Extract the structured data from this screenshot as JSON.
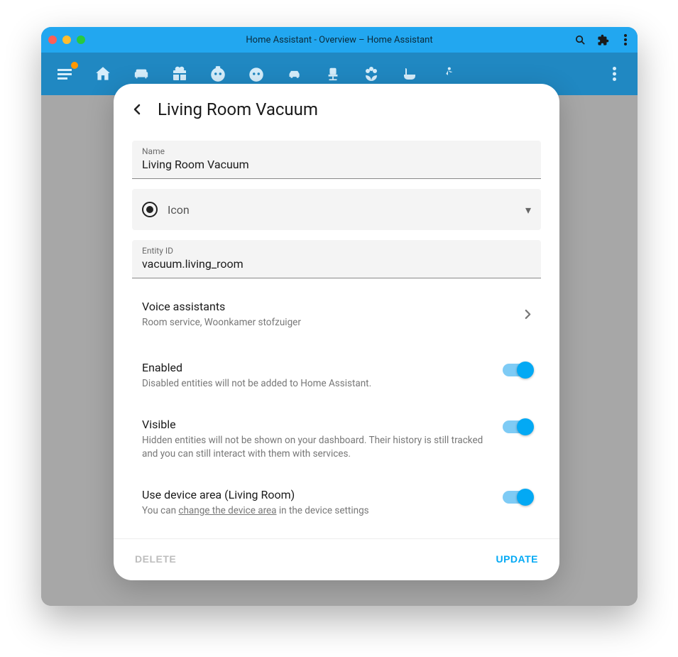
{
  "window": {
    "title": "Home Assistant - Overview – Home Assistant"
  },
  "dialog": {
    "title": "Living Room Vacuum",
    "fields": {
      "name_label": "Name",
      "name_value": "Living Room Vacuum",
      "icon_label": "Icon",
      "entity_id_label": "Entity ID",
      "entity_id_value": "vacuum.living_room"
    },
    "voice": {
      "title": "Voice assistants",
      "subtitle": "Room service, Woonkamer stofzuiger"
    },
    "settings": {
      "enabled": {
        "title": "Enabled",
        "subtitle": "Disabled entities will not be added to Home Assistant.",
        "on": true
      },
      "visible": {
        "title": "Visible",
        "subtitle": "Hidden entities will not be shown on your dashboard. Their history is still tracked and you can still interact with them with services.",
        "on": true
      },
      "area": {
        "title": "Use device area (Living Room)",
        "prefix": "You can ",
        "link": "change the device area",
        "suffix": " in the device settings",
        "on": true
      }
    },
    "buttons": {
      "delete": "DELETE",
      "update": "UPDATE"
    }
  },
  "toolbar_icons": [
    "menu",
    "home",
    "sofa",
    "gift",
    "robot1",
    "robot2",
    "car",
    "chair",
    "flower",
    "bath",
    "run"
  ]
}
